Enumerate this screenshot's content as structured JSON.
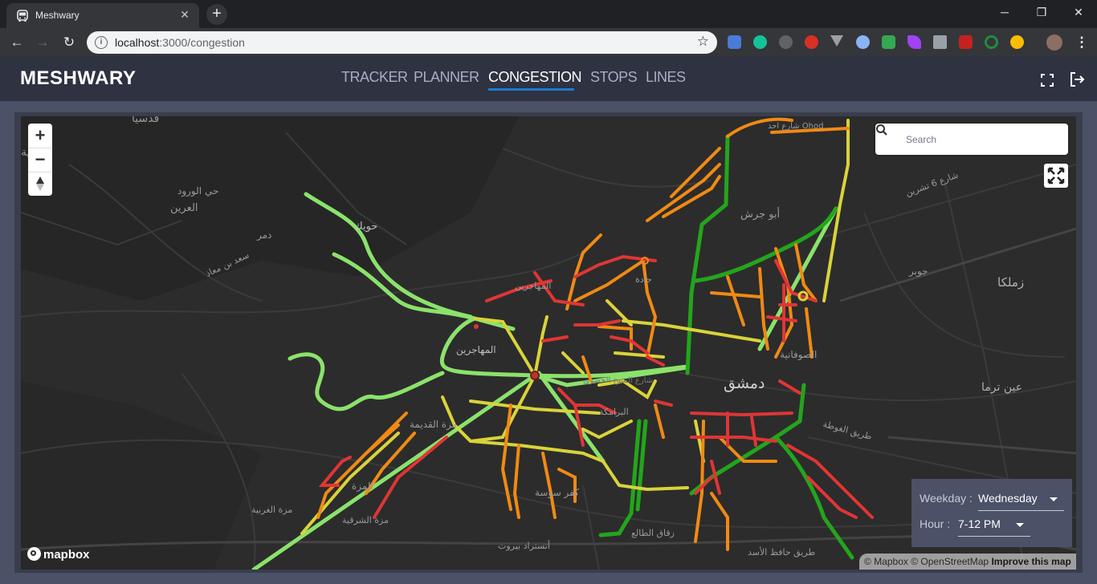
{
  "browser": {
    "tab_title": "Meshwary",
    "url_host": "localhost",
    "url_path": ":3000/congestion"
  },
  "app": {
    "logo": "MESHWARY",
    "nav": [
      {
        "label": "TRACKER"
      },
      {
        "label": "PLANNER"
      },
      {
        "label": "CONGESTION",
        "active": true
      },
      {
        "label": "STOPS"
      },
      {
        "label": "LINES"
      }
    ]
  },
  "map": {
    "search_placeholder": "Search",
    "zoom_in": "+",
    "zoom_out": "−",
    "brand": "mapbox",
    "attribution": {
      "mapbox": "© Mapbox",
      "osm": "© OpenStreetMap",
      "improve": "Improve this map"
    },
    "labels": {
      "qudsaya": "قدسيا",
      "dahiya": "ضاحية",
      "hay_wurud": "حي الورود",
      "areen": "العرين",
      "dummar": "دمر",
      "saad": "سعد بن معاذ",
      "huwaik": "حويك",
      "abu_jarash": "أبو جرش",
      "ohod": "شارع احد Ohod",
      "tishreen": "شارع 6 تشرين",
      "jobar": "جوبر",
      "zamalka": "زملكا",
      "muhajirin1": "المهاجرين",
      "muhajirin2": "المهاجرين",
      "jisr": "جادة",
      "sufaniya": "الصوفانية",
      "dimashq": "دمشق",
      "ein_tarma": "عين ترما",
      "mazza_qadima": "مزة القديمة",
      "ghouta": "طريق الغوطة",
      "baramkeh": "البرامكة",
      "mazza": "المزة",
      "kafar_sousa": "كفر سوسة",
      "mazza_gharbiya": "مزة الغربية",
      "mazza_sharqiya": "مزة الشرقية",
      "zuqaq": "زقاق الطالع",
      "hafez_asad": "طريق حافظ الأسد",
      "ostrad": "أتستراد بيروت",
      "sheikh": "شارع الشيخ الحصري"
    }
  },
  "filters": {
    "weekday_label": "Weekday :",
    "weekday_value": "Wednesday",
    "hour_label": "Hour :",
    "hour_value": "7-12 PM"
  },
  "legend_colors": {
    "free": "#8be26b",
    "light": "#23a51c",
    "moderate": "#d9d33a",
    "heavy": "#f08a14",
    "severe": "#e03535"
  }
}
